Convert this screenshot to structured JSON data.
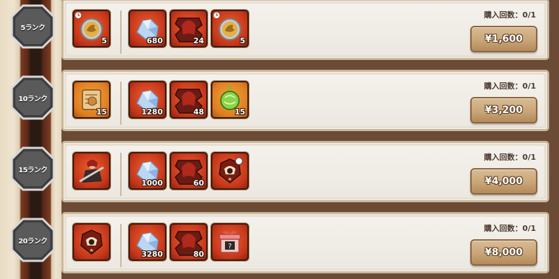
{
  "tiers": [
    {
      "rank": "5ランク",
      "purchase_count": "購入回数：0/1",
      "price": "¥1,600",
      "featured": {
        "icon": "medal-coin-icon",
        "qty": "5",
        "timer": true
      },
      "items": [
        {
          "icon": "crystal-icon",
          "qty": "680"
        },
        {
          "icon": "character-shard-icon",
          "qty": "24"
        },
        {
          "icon": "medal-coin-icon",
          "qty": "5",
          "timer": true
        }
      ]
    },
    {
      "rank": "10ランク",
      "purchase_count": "購入回数：0/1",
      "price": "¥3,200",
      "featured": {
        "icon": "scroll-map-icon",
        "qty": "15"
      },
      "items": [
        {
          "icon": "crystal-icon",
          "qty": "1280"
        },
        {
          "icon": "character-shard-icon",
          "qty": "48"
        },
        {
          "icon": "green-orb-icon",
          "qty": "15"
        }
      ]
    },
    {
      "rank": "15ランク",
      "purchase_count": "購入回数：0/1",
      "price": "¥4,000",
      "featured": {
        "icon": "character-portrait-icon",
        "qty": ""
      },
      "items": [
        {
          "icon": "crystal-icon",
          "qty": "1000"
        },
        {
          "icon": "character-shard-icon",
          "qty": "60"
        },
        {
          "icon": "emblem-badge-icon",
          "qty": ""
        }
      ]
    },
    {
      "rank": "20ランク",
      "purchase_count": "購入回数：0/1",
      "price": "¥8,000",
      "featured": {
        "icon": "emblem-badge-icon",
        "qty": ""
      },
      "items": [
        {
          "icon": "crystal-icon",
          "qty": "3280"
        },
        {
          "icon": "character-shard-icon",
          "qty": "80"
        },
        {
          "icon": "mystery-gift-icon",
          "qty": ""
        }
      ]
    }
  ],
  "colors": {
    "item_red": "#d4421f",
    "item_orange": "#e58a26",
    "button": "#c9a577",
    "rail_dark": "#2a1a12"
  }
}
